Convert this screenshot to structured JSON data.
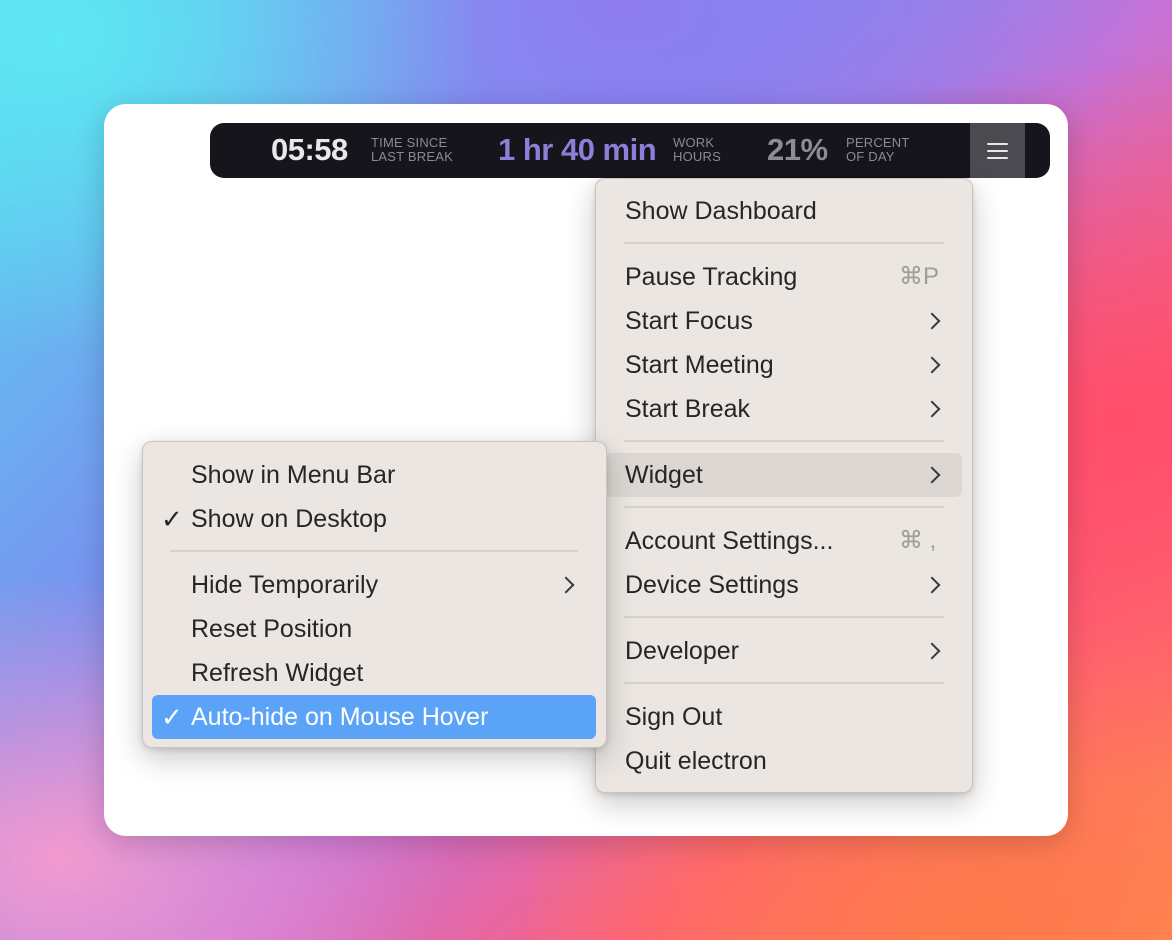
{
  "widget": {
    "time_since_break": {
      "value": "05:58",
      "label_line1": "TIME SINCE",
      "label_line2": "LAST BREAK",
      "color": "#e8e8ea"
    },
    "work_hours": {
      "value": "1 hr 40 min",
      "label_line1": "WORK",
      "label_line2": "HOURS",
      "color": "#8f7ed8"
    },
    "percent_of_day": {
      "value": "21%",
      "label_line1": "PERCENT",
      "label_line2": "OF DAY",
      "color": "#8c8c92"
    },
    "menu_button_icon": "hamburger-icon"
  },
  "main_menu": {
    "items": [
      {
        "label": "Show Dashboard"
      },
      {
        "label": "Pause Tracking",
        "shortcut": "⌘P"
      },
      {
        "label": "Start Focus",
        "submenu": true
      },
      {
        "label": "Start Meeting",
        "submenu": true
      },
      {
        "label": "Start Break",
        "submenu": true
      },
      {
        "label": "Widget",
        "submenu": true,
        "highlighted": true
      },
      {
        "label": "Account Settings...",
        "shortcut": "⌘ ,"
      },
      {
        "label": "Device Settings",
        "submenu": true
      },
      {
        "label": "Developer",
        "submenu": true
      },
      {
        "label": "Sign Out"
      },
      {
        "label": "Quit electron"
      }
    ]
  },
  "widget_submenu": {
    "items": [
      {
        "label": "Show in Menu Bar",
        "checked": false
      },
      {
        "label": "Show on Desktop",
        "checked": true
      },
      {
        "label": "Hide Temporarily",
        "submenu": true
      },
      {
        "label": "Reset Position"
      },
      {
        "label": "Refresh Widget"
      },
      {
        "label": "Auto-hide on Mouse Hover",
        "checked": true,
        "highlighted": true
      }
    ]
  },
  "check_glyph": "✓",
  "colors": {
    "highlight_blue": "#5aa3f7",
    "highlight_gray": "#dcd7d2",
    "menu_bg": "#ebe6e2"
  }
}
